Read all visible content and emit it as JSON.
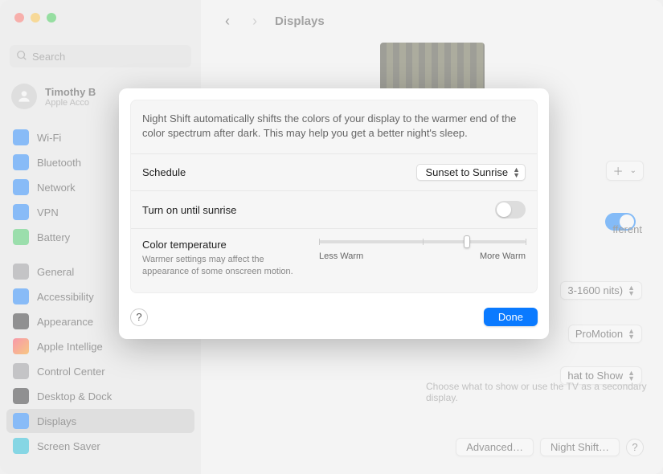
{
  "window": {
    "title": "Displays",
    "search_placeholder": "Search"
  },
  "account": {
    "name": "Timothy B",
    "subtitle": "Apple Acco"
  },
  "sidebar": {
    "items": [
      {
        "label": "Wi-Fi",
        "color": "#0a7aff"
      },
      {
        "label": "Bluetooth",
        "color": "#0a7aff"
      },
      {
        "label": "Network",
        "color": "#0a7aff"
      },
      {
        "label": "VPN",
        "color": "#0a7aff"
      },
      {
        "label": "Battery",
        "color": "#34c759"
      }
    ],
    "items2": [
      {
        "label": "General",
        "color": "#8e8e93"
      },
      {
        "label": "Accessibility",
        "color": "#0a7aff"
      },
      {
        "label": "Appearance",
        "color": "#1c1c1e"
      },
      {
        "label": "Apple Intellige",
        "color": "#ff2d55"
      },
      {
        "label": "Control Center",
        "color": "#8e8e93"
      },
      {
        "label": "Desktop & Dock",
        "color": "#1c1c1e"
      },
      {
        "label": "Displays",
        "color": "#0a7aff",
        "selected": true
      },
      {
        "label": "Screen Saver",
        "color": "#06b6d4"
      }
    ]
  },
  "main": {
    "add_label": "＋",
    "toggle_partial": "fferent",
    "brightness_value": "3-1600 nits)",
    "refresh_value": "ProMotion",
    "tv_value": "hat to Show",
    "tv_desc": "Choose what to show or use the TV as a secondary display.",
    "advanced": "Advanced…",
    "night_shift": "Night Shift…"
  },
  "sheet": {
    "description": "Night Shift automatically shifts the colors of your display to the warmer end of the color spectrum after dark. This may help you get a better night's sleep.",
    "schedule_label": "Schedule",
    "schedule_value": "Sunset to Sunrise",
    "turn_on_label": "Turn on until sunrise",
    "color_title": "Color temperature",
    "color_desc": "Warmer settings may affect the appearance of some onscreen motion.",
    "less_warm": "Less Warm",
    "more_warm": "More Warm",
    "done": "Done",
    "help": "?"
  }
}
